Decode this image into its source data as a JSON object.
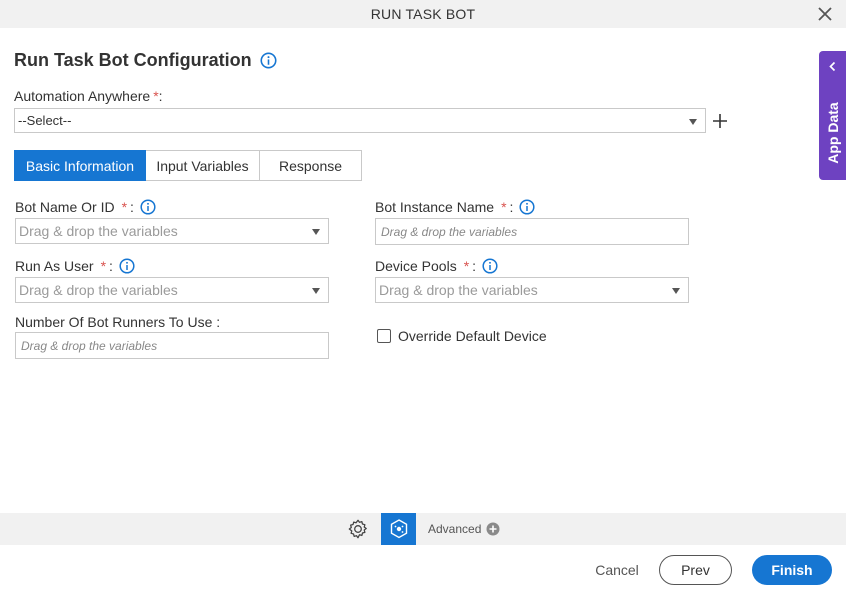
{
  "window": {
    "title": "RUN TASK BOT"
  },
  "heading": {
    "title": "Run Task Bot Configuration"
  },
  "automation": {
    "label": "Automation Anywhere",
    "required": "*",
    "colon": ":",
    "value": "--Select--"
  },
  "tabs": [
    {
      "label": "Basic Information",
      "active": true
    },
    {
      "label": "Input Variables",
      "active": false
    },
    {
      "label": "Response",
      "active": false
    }
  ],
  "fields": {
    "bot_name": {
      "label": "Bot Name Or ID",
      "required": "*",
      "colon": ":",
      "placeholder": "Drag & drop the variables"
    },
    "bot_instance": {
      "label": "Bot Instance Name",
      "required": "*",
      "colon": ":",
      "placeholder": "Drag & drop the variables"
    },
    "run_as_user": {
      "label": "Run As User",
      "required": "*",
      "colon": ":",
      "placeholder": "Drag & drop the variables"
    },
    "device_pools": {
      "label": "Device Pools",
      "required": "*",
      "colon": ":",
      "placeholder": "Drag & drop the variables"
    },
    "bot_runners": {
      "label": "Number Of Bot Runners To Use :",
      "placeholder": "Drag & drop the variables"
    },
    "override_device": {
      "label": "Override Default Device",
      "checked": false
    }
  },
  "side_panel": {
    "label": "App Data"
  },
  "footer": {
    "advanced_label": "Advanced",
    "cancel": "Cancel",
    "prev": "Prev",
    "finish": "Finish"
  },
  "colors": {
    "primary": "#1676d2",
    "app_data": "#6e42c1",
    "required": "#d9534f",
    "bar_bg": "#f1f1f1"
  },
  "icons": {
    "close": "close-icon",
    "info": "info-icon",
    "add": "plus-icon",
    "chevron": "chevron-left-icon",
    "settings": "gear-icon",
    "bot": "bot-icon",
    "advanced": "plus-circle-icon"
  }
}
